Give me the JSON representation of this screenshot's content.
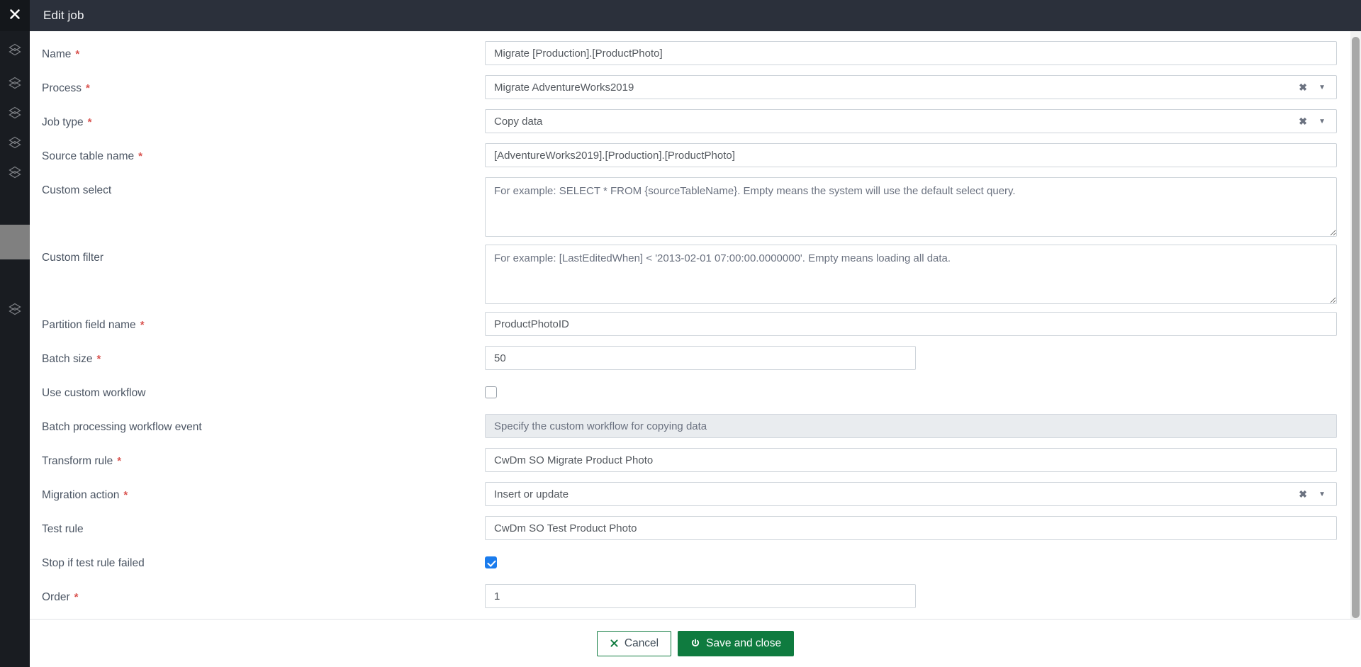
{
  "window": {
    "title": "Edit job",
    "close_icon": "close-icon"
  },
  "sidebar": {
    "items": [
      {
        "icon": "cube-icon"
      },
      {
        "icon": "cube-icon"
      },
      {
        "icon": "cube-icon"
      },
      {
        "icon": "cube-icon"
      },
      {
        "icon": "cube-icon"
      },
      {
        "icon": "active-highlight"
      },
      {
        "icon": "cube-icon"
      }
    ]
  },
  "form": {
    "name": {
      "label": "Name",
      "required": "*",
      "value": "Migrate [Production].[ProductPhoto]"
    },
    "process": {
      "label": "Process",
      "required": "*",
      "value": "Migrate AdventureWorks2019",
      "clear_icon": "✖",
      "caret_icon": "▼"
    },
    "job_type": {
      "label": "Job type",
      "required": "*",
      "value": "Copy data",
      "clear_icon": "✖",
      "caret_icon": "▼"
    },
    "source_table_name": {
      "label": "Source table name",
      "required": "*",
      "value": "[AdventureWorks2019].[Production].[ProductPhoto]"
    },
    "custom_select": {
      "label": "Custom select",
      "value": "",
      "placeholder": "For example: SELECT * FROM {sourceTableName}. Empty means the system will use the default select query."
    },
    "custom_filter": {
      "label": "Custom filter",
      "value": "",
      "placeholder": "For example: [LastEditedWhen] < '2013-02-01 07:00:00.0000000'. Empty means loading all data."
    },
    "partition_field_name": {
      "label": "Partition field name",
      "required": "*",
      "value": "ProductPhotoID"
    },
    "batch_size": {
      "label": "Batch size",
      "required": "*",
      "value": "50"
    },
    "use_custom_workflow": {
      "label": "Use custom workflow",
      "checked": false
    },
    "batch_processing_workflow_event": {
      "label": "Batch processing workflow event",
      "value": "",
      "placeholder": "Specify the custom workflow for copying data",
      "disabled": true
    },
    "transform_rule": {
      "label": "Transform rule",
      "required": "*",
      "value": "CwDm SO Migrate Product Photo"
    },
    "migration_action": {
      "label": "Migration action",
      "required": "*",
      "value": "Insert or update",
      "clear_icon": "✖",
      "caret_icon": "▼"
    },
    "test_rule": {
      "label": "Test rule",
      "value": "CwDm SO Test Product Photo"
    },
    "stop_if_test_rule_failed": {
      "label": "Stop if test rule failed",
      "checked": true
    },
    "order": {
      "label": "Order",
      "required": "*",
      "value": "1"
    }
  },
  "footer": {
    "cancel_label": "Cancel",
    "save_label": "Save and close",
    "cancel_icon": "close-x-icon",
    "save_icon": "power-icon"
  },
  "colors": {
    "header_bg": "#2b303b",
    "sidebar_bg": "#191c21",
    "accent_green": "#0f7b3f",
    "required_red": "#d9534f",
    "checkbox_blue": "#1b7ced"
  }
}
